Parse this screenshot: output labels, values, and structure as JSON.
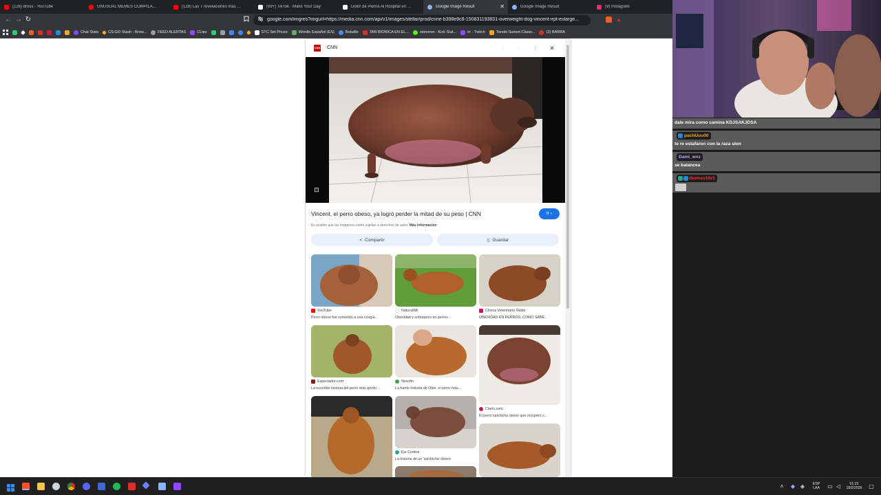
{
  "browser": {
    "tabs": [
      {
        "label": "(128) dross - YouTube",
        "color": "#ff0000"
      },
      {
        "label": "UNUSUAL MEMES COMPILATION V.",
        "color": "#ff0000"
      },
      {
        "label": "(128) Las 7 revelaciones más perturb",
        "color": "#ff0000"
      },
      {
        "label": "(99+) TikTok - Make Your Day",
        "color": "#ffffff"
      },
      {
        "label": "Dolor de Pierna Al Hospital en 2021",
        "color": "#ffffff"
      },
      {
        "label": "Google Image Result",
        "color": "#8ab4f8"
      },
      {
        "label": "Google Image Result",
        "color": "#8ab4f8"
      },
      {
        "label": "(9) Instagram",
        "color": "#e1306c"
      }
    ],
    "tab_close": "✕",
    "nav": {
      "back": "←",
      "forward": "→",
      "reload": "↻"
    },
    "url": "google.com/imgres?imgurl=https://media.cnn.com/api/v1/images/stellar/prod/cnne-b398e9c8-150831193831-overweight-dog-vincent-irpt-exlarge...",
    "bookmarks": [
      {
        "label": "",
        "color": "#2ecc71"
      },
      {
        "label": "",
        "color": "#ffffff"
      },
      {
        "label": "",
        "color": "#e8602c"
      },
      {
        "label": "",
        "color": "#d93025"
      },
      {
        "label": "",
        "color": "#c71f37"
      },
      {
        "label": "",
        "color": "#1f8ad6"
      },
      {
        "label": "",
        "color": "#f5a623"
      },
      {
        "label": "Chat Stats",
        "color": "#7c4dff"
      },
      {
        "label": "CS:GO Stash - Brow...",
        "color": "#f5a623"
      },
      {
        "label": "FEED ALERTAS",
        "color": "#9e9e9e"
      },
      {
        "label": "CLips",
        "color": "#9146ff"
      },
      {
        "label": "",
        "color": "#2ecc71"
      },
      {
        "label": "",
        "color": "#9aa0a6"
      },
      {
        "label": "",
        "color": "#4285f4"
      },
      {
        "label": "",
        "color": "#4285f4"
      },
      {
        "label": "",
        "color": "#f5a623"
      },
      {
        "label": "STC Set Prices",
        "color": "#ffffff"
      },
      {
        "label": "Wordle Español (ES)",
        "color": "#6aaa64"
      },
      {
        "label": "Boludle",
        "color": "#4a90e2"
      },
      {
        "label": "TAN BIONICA EN EL...",
        "color": "#d93025"
      },
      {
        "label": "sioneron - Kick Stat...",
        "color": "#53fc18"
      },
      {
        "label": "lrr - Twitch",
        "color": "#9146ff"
      },
      {
        "label": "Tanoki Sunset Classi...",
        "color": "#f5a623"
      },
      {
        "label": "(2) BARRA",
        "color": "#d93025"
      }
    ]
  },
  "panel": {
    "source": "CNN",
    "logo_text": "CNN",
    "caption": "Vincent, el perro obeso, ya logró perder la mitad de su peso | CNN",
    "go_button": "Ir ›",
    "copyright": "Es posible que las imágenes estén sujetas a derechos de autor.",
    "more_info": "Más información",
    "share_label": "Compartir",
    "save_label": "Guardar",
    "menu_icon": "⋮",
    "close_icon": "✕",
    "prev_icon": "‹",
    "next_icon": "›",
    "lens_icon": "⊡",
    "share_icon": "<",
    "save_icon": "▯",
    "grid": [
      {
        "source": "YouTube",
        "title": "Perro obeso fue sometido a una cirugía...",
        "src_color": "#ff0000"
      },
      {
        "source": "NaturalWil",
        "title": "Obesidad y sobrepeso en perros -",
        "src_color": "#e8eaed"
      },
      {
        "source": "Clínica Veterinaria Galán",
        "title": "OBESIDAD EN PERROS: CÓMO SABE...",
        "src_color": "#c2185b"
      },
      {
        "source": "Espectador.com",
        "title": "La increíble historia del perro más gordo ...",
        "src_color": "#8b1a1a"
      },
      {
        "source": "Nexofin",
        "title": "La fuerte historia de Obie, el perro más...",
        "src_color": "#43a047"
      },
      {
        "source": "Clarín.com",
        "title": "El perro salchicha obeso que recuperó s...",
        "src_color": "#c2185b"
      },
      {
        "source": "Eje Central",
        "title": "La historia de un 'salchicha' obeso",
        "src_color": "#26a69a"
      }
    ]
  },
  "chat": {
    "messages": [
      {
        "user": "",
        "text": "dale mira como camina KDJSAKJDSA",
        "user_color": ""
      },
      {
        "user": "pachUuu00",
        "text": "te re estafaron con la raza sion",
        "user_color": "#f5a623"
      },
      {
        "user": "Dami_wxz",
        "text": "se balancea",
        "user_color": "#c9a3ff"
      },
      {
        "user": "thomas16z5",
        "text": "",
        "user_color": "#e53935"
      }
    ]
  },
  "taskbar": {
    "icons": [
      {
        "name": "windows-start-icon",
        "color": "#3a8dde"
      },
      {
        "name": "brave-browser-icon",
        "color": "#fb542b"
      },
      {
        "name": "file-explorer-icon",
        "color": "#f6c445"
      },
      {
        "name": "steam-icon",
        "color": "#c7d5e0"
      },
      {
        "name": "chrome-icon",
        "color": "#d93025"
      },
      {
        "name": "discord-icon",
        "color": "#5865f2"
      },
      {
        "name": "app-icon-blue",
        "color": "#3b6ad6"
      },
      {
        "name": "spotify-icon",
        "color": "#1db954"
      },
      {
        "name": "news-app-icon",
        "color": "#d93025"
      },
      {
        "name": "vpn-icon",
        "color": "#6d7dff"
      },
      {
        "name": "app-icon-puzzle",
        "color": "#8ab4f8"
      },
      {
        "name": "twitch-studio-icon",
        "color": "#9146ff"
      }
    ],
    "lang": "ESP",
    "lang_sub": "LAA",
    "time": "01:22",
    "date": "18/2/2026"
  }
}
